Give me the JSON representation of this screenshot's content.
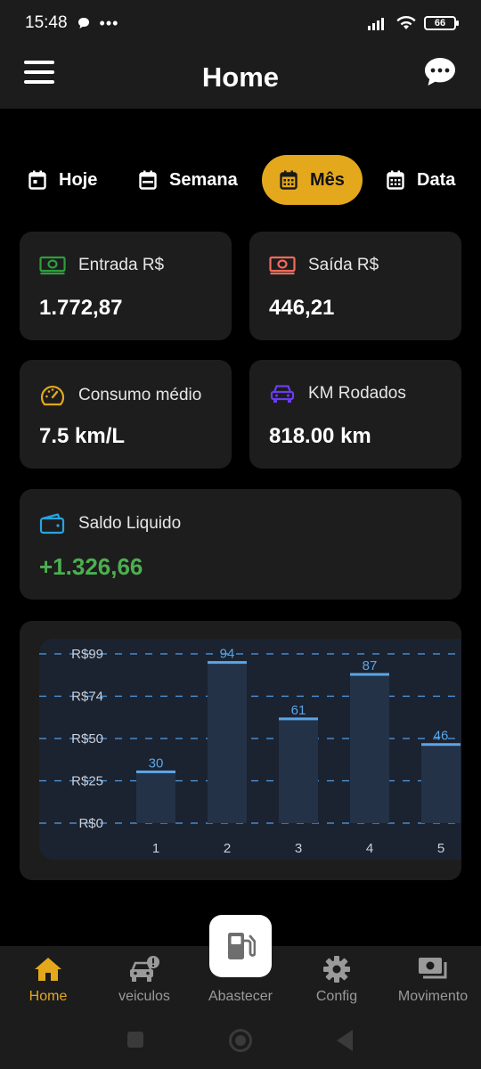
{
  "status": {
    "time": "15:48",
    "battery": "66"
  },
  "app": {
    "title": "Home"
  },
  "tabs": [
    {
      "label": "Hoje",
      "active": false
    },
    {
      "label": "Semana",
      "active": false
    },
    {
      "label": "Mês",
      "active": true
    },
    {
      "label": "Data",
      "active": false
    }
  ],
  "cards": {
    "entrada": {
      "label": "Entrada R$",
      "value": "1.772,87",
      "icon": "money-icon",
      "color": "#2e9e3f"
    },
    "saida": {
      "label": "Saída R$",
      "value": "446,21",
      "icon": "money-icon",
      "color": "#f06b5b"
    },
    "consumo": {
      "label": "Consumo médio",
      "value": "7.5 km/L",
      "icon": "speedometer-icon",
      "color": "#e4a81d"
    },
    "km": {
      "label": "KM Rodados",
      "value": "818.00 km",
      "icon": "car-icon",
      "color": "#6a3df0"
    },
    "saldo": {
      "label": "Saldo Liquido",
      "value": "+1.326,66",
      "icon": "wallet-icon",
      "color": "#29a3e0"
    }
  },
  "chart_data": {
    "type": "bar",
    "categories": [
      "1",
      "2",
      "3",
      "4",
      "5"
    ],
    "values": [
      30,
      94,
      61,
      87,
      46
    ],
    "value_labels": [
      "30",
      "94",
      "61",
      "87",
      "46"
    ],
    "y_ticks": [
      "R$0",
      "R$25",
      "R$50",
      "R$74",
      "R$99"
    ],
    "ylim": [
      0,
      99
    ],
    "grid": true,
    "bar_color": "#243247",
    "bar_top_color": "#5aa6e8",
    "label_color": "#5aa6e8"
  },
  "nav": {
    "items": [
      {
        "label": "Home",
        "icon": "home-icon",
        "active": true
      },
      {
        "label": "veiculos",
        "icon": "car-alert-icon",
        "active": false
      },
      {
        "label": "Abastecer",
        "icon": "fuel-pump-icon",
        "active": false
      },
      {
        "label": "Config",
        "icon": "gear-icon",
        "active": false
      },
      {
        "label": "Movimento",
        "icon": "cash-icon",
        "active": false
      }
    ]
  }
}
